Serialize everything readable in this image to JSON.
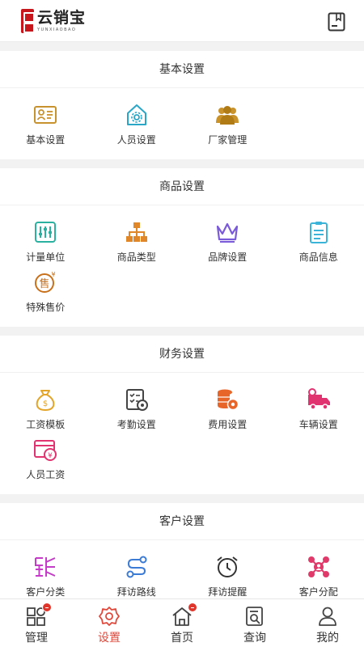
{
  "header": {
    "app_name": "云销宝",
    "app_name_en": "YUNXIAOBAO"
  },
  "sections": [
    {
      "title": "基本设置",
      "items": [
        {
          "label": "基本设置",
          "icon": "id-card-icon"
        },
        {
          "label": "人员设置",
          "icon": "house-gear-icon"
        },
        {
          "label": "厂家管理",
          "icon": "group-icon"
        }
      ]
    },
    {
      "title": "商品设置",
      "items": [
        {
          "label": "计量单位",
          "icon": "scale-icon"
        },
        {
          "label": "商品类型",
          "icon": "hierarchy-icon"
        },
        {
          "label": "品牌设置",
          "icon": "crown-icon"
        },
        {
          "label": "商品信息",
          "icon": "clipboard-icon"
        },
        {
          "label": "特殊售价",
          "icon": "price-tag-icon"
        }
      ]
    },
    {
      "title": "财务设置",
      "items": [
        {
          "label": "工资模板",
          "icon": "money-bag-icon"
        },
        {
          "label": "考勤设置",
          "icon": "checklist-gear-icon"
        },
        {
          "label": "费用设置",
          "icon": "coins-gear-icon"
        },
        {
          "label": "车辆设置",
          "icon": "truck-icon"
        },
        {
          "label": "人员工资",
          "icon": "wallet-icon"
        }
      ]
    },
    {
      "title": "客户设置",
      "items": [
        {
          "label": "客户分类",
          "icon": "category-icon"
        },
        {
          "label": "拜访路线",
          "icon": "route-icon"
        },
        {
          "label": "拜访提醒",
          "icon": "alarm-clock-icon"
        },
        {
          "label": "客户分配",
          "icon": "distribution-icon"
        }
      ]
    }
  ],
  "tabs": [
    {
      "label": "管理",
      "icon": "grid-icon",
      "badge": true
    },
    {
      "label": "设置",
      "icon": "settings-icon",
      "active": true
    },
    {
      "label": "首页",
      "icon": "home-icon",
      "badge": true
    },
    {
      "label": "查询",
      "icon": "search-doc-icon"
    },
    {
      "label": "我的",
      "icon": "user-icon"
    }
  ],
  "colors": {
    "active_tab": "#e0483b",
    "badge": "#e0352a"
  }
}
